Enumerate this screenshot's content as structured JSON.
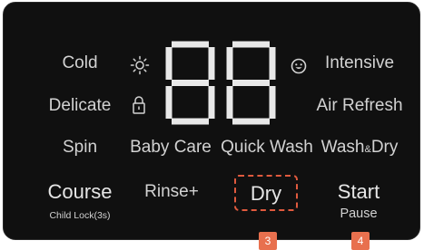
{
  "panel": {
    "row1": {
      "left": "Cold",
      "right": "Intensive"
    },
    "row2": {
      "left": "Delicate",
      "right": "Air Refresh"
    },
    "row3": {
      "left": "Spin",
      "mid_left": "Baby Care",
      "mid_right": "Quick Wash",
      "right_a": "Wash",
      "right_amp": "&",
      "right_b": "Dry"
    },
    "row4": {
      "course": "Course",
      "course_sub": "Child Lock(3s)",
      "rinse": "Rinse+",
      "dry": "Dry",
      "start": "Start",
      "start_sub": "Pause"
    },
    "display": {
      "digits": "88"
    },
    "icons": {
      "sun": "sun-icon",
      "lock": "lock-icon",
      "smile": "smile-icon"
    }
  },
  "markers": {
    "dry": "3",
    "start": "4"
  },
  "colors": {
    "panel_bg": "#101010",
    "text": "#d2d2d2",
    "highlight": "#e05a3e",
    "marker_bg": "#e8704e"
  }
}
